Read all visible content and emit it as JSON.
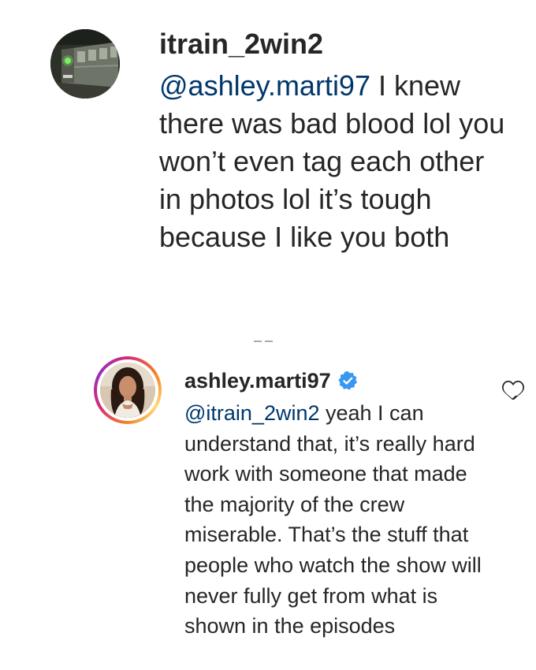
{
  "comment1": {
    "username": "itrain_2win2",
    "mention": "@ashley.marti97",
    "text": " I knew there was bad blood lol you won’t even tag each other in photos lol it’s tough because I like you both",
    "avatar_icon": "subway-train-avatar"
  },
  "comment2": {
    "username": "ashley.marti97",
    "verified_icon": "verified-badge-icon",
    "mention": "@itrain_2win2",
    "text": " yeah I can understand that, it’s really hard work with someone that made the majority of the crew miserable. That’s the stuff that people who watch the show will never fully get from what is shown in the episodes",
    "avatar_icon": "profile-photo-avatar",
    "like_icon": "heart-outline-icon"
  },
  "colors": {
    "text": "#262626",
    "mention": "#00376b",
    "verified": "#3897f0"
  }
}
